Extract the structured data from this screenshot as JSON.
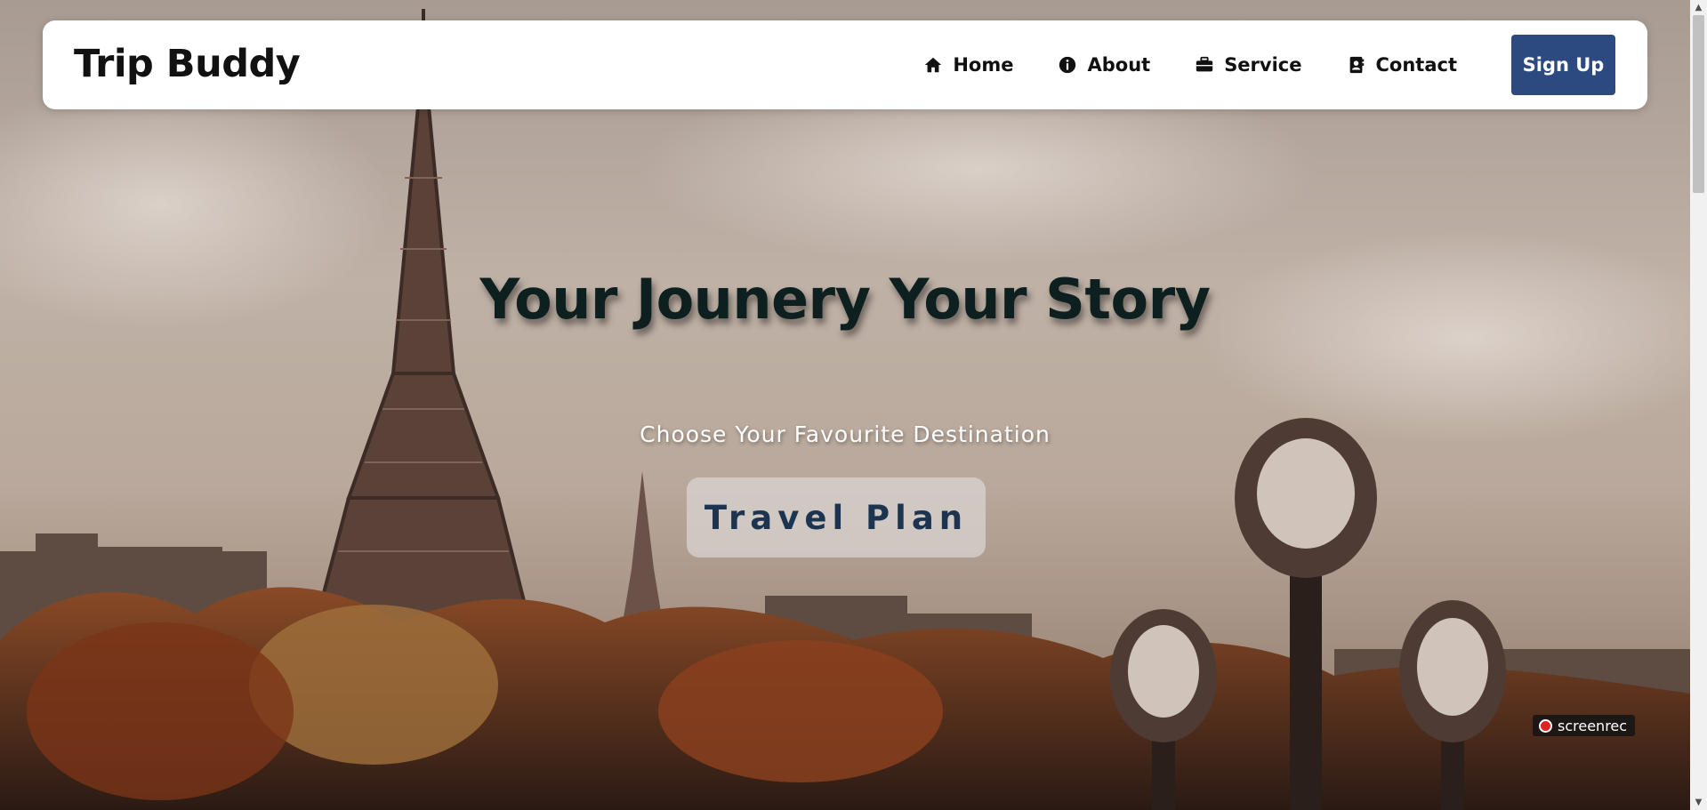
{
  "navbar": {
    "brand": "Trip Buddy",
    "items": [
      {
        "label": "Home",
        "icon": "home-icon"
      },
      {
        "label": "About",
        "icon": "info-icon"
      },
      {
        "label": "Service",
        "icon": "briefcase-icon"
      },
      {
        "label": "Contact",
        "icon": "contact-book-icon"
      }
    ],
    "signup_label": "Sign Up"
  },
  "hero": {
    "title": "Your Jounery Your Story",
    "subtitle": "Choose Your Favourite Destination",
    "cta_label": "Travel Plan"
  },
  "overlay": {
    "recorder_label": "screenrec"
  },
  "colors": {
    "accent": "#2d4a80",
    "title": "#0d1f1f",
    "cta_text": "#1c3450"
  }
}
